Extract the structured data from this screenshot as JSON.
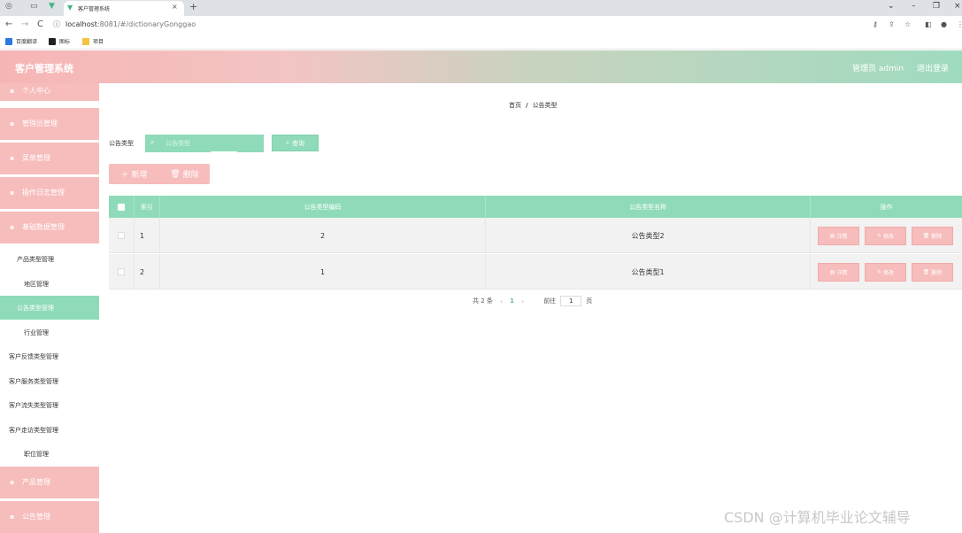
{
  "browser": {
    "tab_title": "客户管理系统",
    "url_host": "localhost",
    "url_rest": ":8081/#/dictionaryGonggao",
    "bookmarks": [
      "百度翻译",
      "图标",
      "项目"
    ]
  },
  "header": {
    "title": "客户管理系统",
    "user": "管理员 admin",
    "logout": "退出登录"
  },
  "sidebar": {
    "top_menus": [
      "个人中心",
      "管理员管理",
      "菜单管理",
      "操作日志管理",
      "基础数据管理"
    ],
    "sub_items": [
      "产品类型管理",
      "地区管理",
      "公告类型管理",
      "行业管理",
      "客户反馈类型管理",
      "客户服务类型管理",
      "客户流失类型管理",
      "客户走访类型管理",
      "职位管理"
    ],
    "active_sub": "公告类型管理",
    "bottom_menus": [
      "产品管理",
      "公告管理"
    ]
  },
  "breadcrumb": {
    "home": "首页",
    "sep": "/",
    "current": "公告类型"
  },
  "search": {
    "label": "公告类型",
    "placeholder": "公告类型",
    "button": "查询"
  },
  "actions": {
    "add": "新增",
    "delete": "删除"
  },
  "table": {
    "headers": {
      "index": "索引",
      "code": "公告类型编码",
      "name": "公告类型名称",
      "ops": "操作"
    },
    "rows": [
      {
        "index": "1",
        "code": "2",
        "name": "公告类型2"
      },
      {
        "index": "2",
        "code": "1",
        "name": "公告类型1"
      }
    ],
    "op_labels": {
      "detail": "详情",
      "edit": "修改",
      "delete": "删除"
    }
  },
  "pagination": {
    "total": "共 2 条",
    "current": "1",
    "goto_prefix": "前往",
    "goto_value": "1",
    "goto_suffix": "页"
  },
  "watermark": "CSDN @计算机毕业论文辅导",
  "colors": {
    "pink": "#f7bcbc",
    "green": "#8fdbb9"
  }
}
